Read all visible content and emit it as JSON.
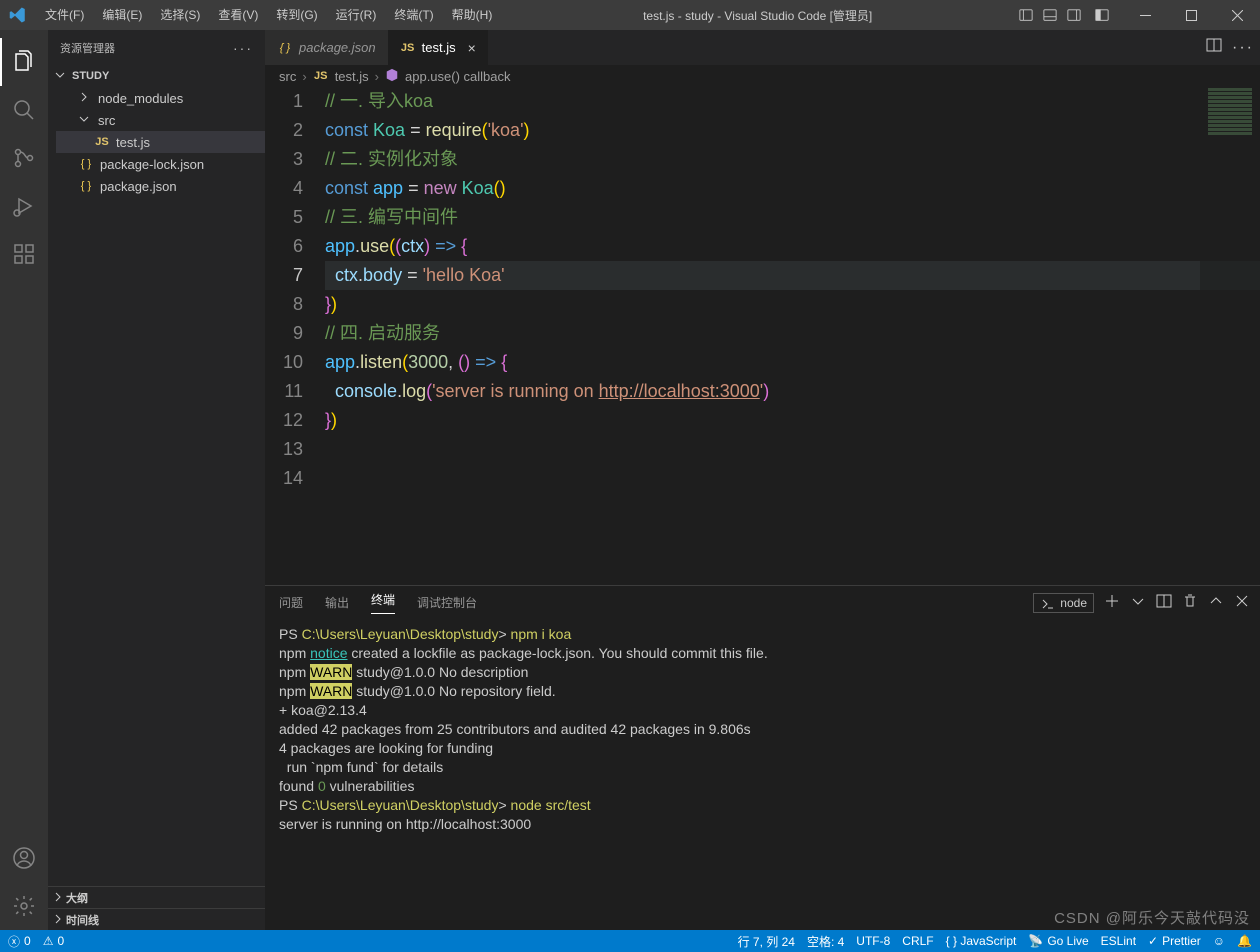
{
  "menu": [
    "文件(F)",
    "编辑(E)",
    "选择(S)",
    "查看(V)",
    "转到(G)",
    "运行(R)",
    "终端(T)",
    "帮助(H)"
  ],
  "window_title": "test.js - study - Visual Studio Code [管理员]",
  "sidebar": {
    "header": "资源管理器",
    "root": "STUDY",
    "items": [
      {
        "label": "node_modules",
        "depth": 2,
        "expand": "r"
      },
      {
        "label": "src",
        "depth": 2,
        "expand": "d"
      },
      {
        "label": "test.js",
        "depth": 3,
        "icon": "JS"
      },
      {
        "label": "package-lock.json",
        "depth": 2,
        "icon": "{ }"
      },
      {
        "label": "package.json",
        "depth": 2,
        "icon": "{ }"
      }
    ],
    "outline": "大纲",
    "timeline": "时间线"
  },
  "tabs": [
    {
      "label": "package.json",
      "icon": "{ }",
      "active": false
    },
    {
      "label": "test.js",
      "icon": "JS",
      "active": true
    }
  ],
  "breadcrumbs": [
    "src",
    "test.js",
    "app.use() callback"
  ],
  "code_lines": [
    [
      [
        "c-cm",
        "// 一. 导入koa"
      ]
    ],
    [
      [
        "c-kw",
        "const "
      ],
      [
        "c-cl",
        "Koa"
      ],
      [
        "c-pn",
        " = "
      ],
      [
        "c-fn",
        "require"
      ],
      [
        "c-par",
        "("
      ],
      [
        "c-str",
        "'koa'"
      ],
      [
        "c-par",
        ")"
      ]
    ],
    [
      [
        "c-cm",
        "// 二. 实例化对象"
      ]
    ],
    [
      [
        "c-kw",
        "const "
      ],
      [
        "c-var",
        "app"
      ],
      [
        "c-pn",
        " = "
      ],
      [
        "c-kw2",
        "new"
      ],
      [
        "c-pn",
        " "
      ],
      [
        "c-cl",
        "Koa"
      ],
      [
        "c-par",
        "()"
      ]
    ],
    [
      [
        "c-cm",
        "// 三. 编写中间件"
      ]
    ],
    [
      [
        "c-var",
        "app"
      ],
      [
        "c-pn",
        "."
      ],
      [
        "c-fn",
        "use"
      ],
      [
        "c-par",
        "("
      ],
      [
        "c-par2",
        "("
      ],
      [
        "c-pr",
        "ctx"
      ],
      [
        "c-par2",
        ")"
      ],
      [
        "c-kw",
        " => "
      ],
      [
        "c-par2",
        "{"
      ]
    ],
    [
      [
        "c-pn",
        "  "
      ],
      [
        "c-pr",
        "ctx"
      ],
      [
        "c-pn",
        "."
      ],
      [
        "c-pr",
        "body"
      ],
      [
        "c-pn",
        " = "
      ],
      [
        "c-str",
        "'hello Koa'"
      ]
    ],
    [
      [
        "c-par2",
        "}"
      ],
      [
        "c-par",
        ")"
      ]
    ],
    [
      [
        "c-cm",
        "// 四. 启动服务"
      ]
    ],
    [
      [
        "c-var",
        "app"
      ],
      [
        "c-pn",
        "."
      ],
      [
        "c-fn",
        "listen"
      ],
      [
        "c-par",
        "("
      ],
      [
        "c-num",
        "3000"
      ],
      [
        "c-pn",
        ", "
      ],
      [
        "c-par2",
        "()"
      ],
      [
        "c-kw",
        " => "
      ],
      [
        "c-par2",
        "{"
      ]
    ],
    [
      [
        "c-pn",
        "  "
      ],
      [
        "c-pr",
        "console"
      ],
      [
        "c-pn",
        "."
      ],
      [
        "c-fn",
        "log"
      ],
      [
        "c-par2",
        "("
      ],
      [
        "c-str",
        "'server is running on "
      ],
      [
        "c-lnk",
        "http://localhost:3000"
      ],
      [
        "c-str",
        "'"
      ],
      [
        "c-par2",
        ")"
      ]
    ],
    [
      [
        "c-par2",
        "}"
      ],
      [
        "c-par",
        ")"
      ]
    ],
    [
      [
        "",
        ""
      ]
    ],
    [
      [
        "",
        ""
      ]
    ]
  ],
  "current_line": 7,
  "panel": {
    "tabs": [
      "问题",
      "输出",
      "终端",
      "调试控制台"
    ],
    "active": 2,
    "dropdown": "node",
    "output": [
      [
        [
          "",
          "PS "
        ],
        [
          "t-path",
          "C:\\Users\\Leyuan\\Desktop\\study"
        ],
        [
          "",
          "> "
        ],
        [
          "t-cmd",
          "npm i koa"
        ]
      ],
      [
        [
          "",
          "npm "
        ],
        [
          "t-notice",
          "notice"
        ],
        [
          "",
          " created a lockfile as package-lock.json. You should commit this file."
        ]
      ],
      [
        [
          "",
          "npm "
        ],
        [
          "t-warn",
          "WARN"
        ],
        [
          "",
          " study@1.0.0 No description"
        ]
      ],
      [
        [
          "",
          "npm "
        ],
        [
          "t-warn",
          "WARN"
        ],
        [
          "",
          " study@1.0.0 No repository field."
        ]
      ],
      [
        [
          "",
          ""
        ]
      ],
      [
        [
          "",
          "+ koa@2.13.4"
        ]
      ],
      [
        [
          "",
          "added 42 packages from 25 contributors and audited 42 packages in 9.806s"
        ]
      ],
      [
        [
          "",
          ""
        ]
      ],
      [
        [
          "",
          "4 packages are looking for funding"
        ]
      ],
      [
        [
          "",
          "  run `npm fund` for details"
        ]
      ],
      [
        [
          "",
          ""
        ]
      ],
      [
        [
          "",
          "found "
        ],
        [
          "t-num",
          "0"
        ],
        [
          "",
          " vulnerabilities"
        ]
      ],
      [
        [
          "",
          ""
        ]
      ],
      [
        [
          "",
          "PS "
        ],
        [
          "t-path",
          "C:\\Users\\Leyuan\\Desktop\\study"
        ],
        [
          "",
          "> "
        ],
        [
          "t-cmd",
          "node src/test"
        ]
      ],
      [
        [
          "",
          "server is running on http://localhost:3000"
        ]
      ]
    ]
  },
  "status": {
    "errors": "0",
    "warnings": "0",
    "pos": "行 7, 列 24",
    "spaces": "空格: 4",
    "enc": "UTF-8",
    "eol": "CRLF",
    "lang": "{ } JavaScript",
    "golive": "Go Live",
    "eslint": "ESLint",
    "prettier": "Prettier"
  },
  "watermark": "CSDN @阿乐今天敲代码没"
}
